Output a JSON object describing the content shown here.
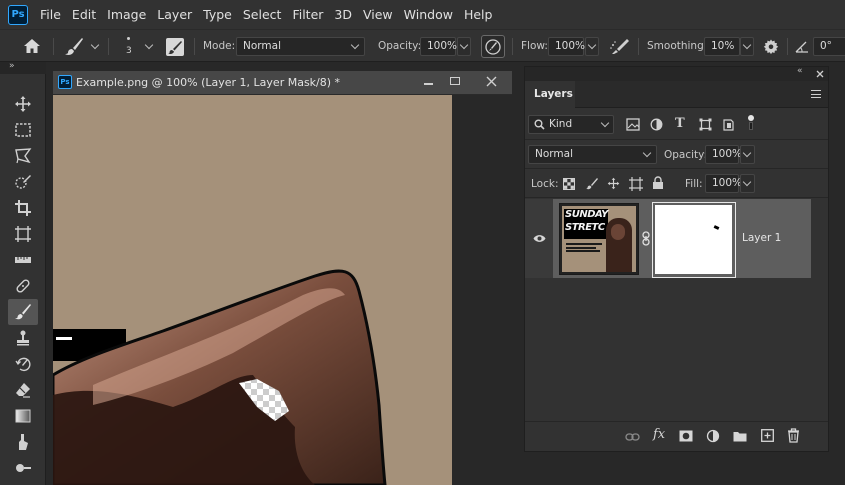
{
  "app": {
    "logo": "Ps"
  },
  "menu": [
    "File",
    "Edit",
    "Image",
    "Layer",
    "Type",
    "Select",
    "Filter",
    "3D",
    "View",
    "Window",
    "Help"
  ],
  "options_bar": {
    "brush_size": "3",
    "mode_label": "Mode:",
    "mode_value": "Normal",
    "opacity_label": "Opacity:",
    "opacity_value": "100%",
    "flow_label": "Flow:",
    "flow_value": "100%",
    "smoothing_label": "Smoothing:",
    "smoothing_value": "10%",
    "angle_value": "0°"
  },
  "document": {
    "title": "Example.png @ 100% (Layer 1, Layer Mask/8) *",
    "canvas_bg": "#a5917a"
  },
  "layers_panel": {
    "tab": "Layers",
    "filter_label": "Kind",
    "blend_mode": "Normal",
    "opacity_label": "Opacity:",
    "opacity_value": "100%",
    "lock_label": "Lock:",
    "fill_label": "Fill:",
    "fill_value": "100%",
    "layers": [
      {
        "name": "Layer 1",
        "thumb_text_line1": "SUNDAY",
        "thumb_text_line2": "STRETC"
      }
    ]
  },
  "colors": {
    "accent": "#31a8ff",
    "panel": "#323232",
    "selected_row": "#5e5e5e"
  }
}
